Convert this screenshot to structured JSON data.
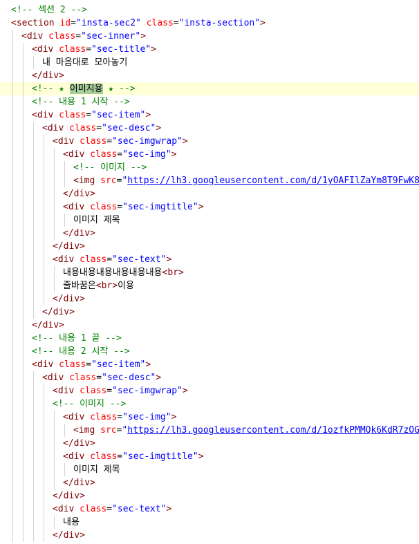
{
  "editor": {
    "language": "html",
    "lines": [
      {
        "indent": 0,
        "tokens": [
          {
            "t": "comment",
            "v": "<!-- 섹션 2 -->"
          }
        ]
      },
      {
        "indent": 0,
        "tokens": [
          {
            "t": "tag",
            "v": "<section"
          },
          {
            "t": "text",
            "v": " "
          },
          {
            "t": "attr",
            "v": "id"
          },
          {
            "t": "text",
            "v": "="
          },
          {
            "t": "value",
            "v": "\"insta-sec2\""
          },
          {
            "t": "text",
            "v": " "
          },
          {
            "t": "attr",
            "v": "class"
          },
          {
            "t": "text",
            "v": "="
          },
          {
            "t": "value",
            "v": "\"insta-section\""
          },
          {
            "t": "tag",
            "v": ">"
          }
        ]
      },
      {
        "indent": 1,
        "tokens": [
          {
            "t": "tag",
            "v": "<div"
          },
          {
            "t": "text",
            "v": " "
          },
          {
            "t": "attr",
            "v": "class"
          },
          {
            "t": "text",
            "v": "="
          },
          {
            "t": "value",
            "v": "\"sec-inner\""
          },
          {
            "t": "tag",
            "v": ">"
          }
        ]
      },
      {
        "indent": 2,
        "tokens": [
          {
            "t": "tag",
            "v": "<div"
          },
          {
            "t": "text",
            "v": " "
          },
          {
            "t": "attr",
            "v": "class"
          },
          {
            "t": "text",
            "v": "="
          },
          {
            "t": "value",
            "v": "\"sec-title\""
          },
          {
            "t": "tag",
            "v": ">"
          }
        ]
      },
      {
        "indent": 3,
        "tokens": [
          {
            "t": "text",
            "v": "내 마음대로 모아놓기"
          }
        ]
      },
      {
        "indent": 2,
        "tokens": [
          {
            "t": "tag",
            "v": "</div>"
          }
        ]
      },
      {
        "indent": 2,
        "highlight": true,
        "tokens": [
          {
            "t": "comment",
            "v": "<!-- ★ "
          },
          {
            "t": "match",
            "v": "이미지용"
          },
          {
            "t": "comment",
            "v": " ★ -->"
          }
        ]
      },
      {
        "indent": 2,
        "tokens": [
          {
            "t": "comment",
            "v": "<!-- 내용 1 시작 -->"
          }
        ]
      },
      {
        "indent": 2,
        "tokens": [
          {
            "t": "tag",
            "v": "<div"
          },
          {
            "t": "text",
            "v": " "
          },
          {
            "t": "attr",
            "v": "class"
          },
          {
            "t": "text",
            "v": "="
          },
          {
            "t": "value",
            "v": "\"sec-item\""
          },
          {
            "t": "tag",
            "v": ">"
          }
        ]
      },
      {
        "indent": 3,
        "tokens": [
          {
            "t": "tag",
            "v": "<div"
          },
          {
            "t": "text",
            "v": " "
          },
          {
            "t": "attr",
            "v": "class"
          },
          {
            "t": "text",
            "v": "="
          },
          {
            "t": "value",
            "v": "\"sec-desc\""
          },
          {
            "t": "tag",
            "v": ">"
          }
        ]
      },
      {
        "indent": 4,
        "tokens": [
          {
            "t": "tag",
            "v": "<div"
          },
          {
            "t": "text",
            "v": " "
          },
          {
            "t": "attr",
            "v": "class"
          },
          {
            "t": "text",
            "v": "="
          },
          {
            "t": "value",
            "v": "\"sec-imgwrap\""
          },
          {
            "t": "tag",
            "v": ">"
          }
        ]
      },
      {
        "indent": 5,
        "tokens": [
          {
            "t": "tag",
            "v": "<div"
          },
          {
            "t": "text",
            "v": " "
          },
          {
            "t": "attr",
            "v": "class"
          },
          {
            "t": "text",
            "v": "="
          },
          {
            "t": "value",
            "v": "\"sec-img\""
          },
          {
            "t": "tag",
            "v": ">"
          }
        ]
      },
      {
        "indent": 6,
        "tokens": [
          {
            "t": "comment",
            "v": "<!-- 이미지 -->"
          }
        ]
      },
      {
        "indent": 6,
        "tokens": [
          {
            "t": "tag",
            "v": "<img"
          },
          {
            "t": "text",
            "v": " "
          },
          {
            "t": "attr",
            "v": "src"
          },
          {
            "t": "text",
            "v": "="
          },
          {
            "t": "value",
            "v": "\""
          },
          {
            "t": "link",
            "v": "https://lh3.googleusercontent.com/d/1yOAFIlZaYm8T9FwK8l"
          }
        ]
      },
      {
        "indent": 5,
        "tokens": [
          {
            "t": "tag",
            "v": "</div>"
          }
        ]
      },
      {
        "indent": 5,
        "tokens": [
          {
            "t": "tag",
            "v": "<div"
          },
          {
            "t": "text",
            "v": " "
          },
          {
            "t": "attr",
            "v": "class"
          },
          {
            "t": "text",
            "v": "="
          },
          {
            "t": "value",
            "v": "\"sec-imgtitle\""
          },
          {
            "t": "tag",
            "v": ">"
          }
        ]
      },
      {
        "indent": 6,
        "tokens": [
          {
            "t": "text",
            "v": "이미지 제목"
          }
        ]
      },
      {
        "indent": 5,
        "tokens": [
          {
            "t": "tag",
            "v": "</div>"
          }
        ]
      },
      {
        "indent": 4,
        "tokens": [
          {
            "t": "tag",
            "v": "</div>"
          }
        ]
      },
      {
        "indent": 4,
        "tokens": [
          {
            "t": "tag",
            "v": "<div"
          },
          {
            "t": "text",
            "v": " "
          },
          {
            "t": "attr",
            "v": "class"
          },
          {
            "t": "text",
            "v": "="
          },
          {
            "t": "value",
            "v": "\"sec-text\""
          },
          {
            "t": "tag",
            "v": ">"
          }
        ]
      },
      {
        "indent": 5,
        "tokens": [
          {
            "t": "text",
            "v": "내용내용내용내용내용내용"
          },
          {
            "t": "tag",
            "v": "<br>"
          }
        ]
      },
      {
        "indent": 5,
        "tokens": [
          {
            "t": "text",
            "v": "줄바꿈은"
          },
          {
            "t": "tag",
            "v": "<br>"
          },
          {
            "t": "text",
            "v": "이용"
          }
        ]
      },
      {
        "indent": 4,
        "tokens": [
          {
            "t": "tag",
            "v": "</div>"
          }
        ]
      },
      {
        "indent": 3,
        "tokens": [
          {
            "t": "tag",
            "v": "</div>"
          }
        ]
      },
      {
        "indent": 2,
        "tokens": [
          {
            "t": "tag",
            "v": "</div>"
          }
        ]
      },
      {
        "indent": 2,
        "tokens": [
          {
            "t": "comment",
            "v": "<!-- 내용 1 끝 -->"
          }
        ]
      },
      {
        "indent": 2,
        "tokens": [
          {
            "t": "comment",
            "v": "<!-- 내용 2 시작 -->"
          }
        ]
      },
      {
        "indent": 2,
        "tokens": [
          {
            "t": "tag",
            "v": "<div"
          },
          {
            "t": "text",
            "v": " "
          },
          {
            "t": "attr",
            "v": "class"
          },
          {
            "t": "text",
            "v": "="
          },
          {
            "t": "value",
            "v": "\"sec-item\""
          },
          {
            "t": "tag",
            "v": ">"
          }
        ]
      },
      {
        "indent": 3,
        "tokens": [
          {
            "t": "tag",
            "v": "<div"
          },
          {
            "t": "text",
            "v": " "
          },
          {
            "t": "attr",
            "v": "class"
          },
          {
            "t": "text",
            "v": "="
          },
          {
            "t": "value",
            "v": "\"sec-desc\""
          },
          {
            "t": "tag",
            "v": ">"
          }
        ]
      },
      {
        "indent": 4,
        "tokens": [
          {
            "t": "tag",
            "v": "<div"
          },
          {
            "t": "text",
            "v": " "
          },
          {
            "t": "attr",
            "v": "class"
          },
          {
            "t": "text",
            "v": "="
          },
          {
            "t": "value",
            "v": "\"sec-imgwrap\""
          },
          {
            "t": "tag",
            "v": ">"
          }
        ]
      },
      {
        "indent": 4,
        "tokens": [
          {
            "t": "comment",
            "v": "<!-- 이미지 -->"
          }
        ]
      },
      {
        "indent": 5,
        "tokens": [
          {
            "t": "tag",
            "v": "<div"
          },
          {
            "t": "text",
            "v": " "
          },
          {
            "t": "attr",
            "v": "class"
          },
          {
            "t": "text",
            "v": "="
          },
          {
            "t": "value",
            "v": "\"sec-img\""
          },
          {
            "t": "tag",
            "v": ">"
          }
        ]
      },
      {
        "indent": 6,
        "tokens": [
          {
            "t": "tag",
            "v": "<img"
          },
          {
            "t": "text",
            "v": " "
          },
          {
            "t": "attr",
            "v": "src"
          },
          {
            "t": "text",
            "v": "="
          },
          {
            "t": "value",
            "v": "\""
          },
          {
            "t": "link",
            "v": "https://lh3.googleusercontent.com/d/1ozfkPMMQk6KdR7zOG_"
          }
        ]
      },
      {
        "indent": 5,
        "tokens": [
          {
            "t": "tag",
            "v": "</div>"
          }
        ]
      },
      {
        "indent": 5,
        "tokens": [
          {
            "t": "tag",
            "v": "<div"
          },
          {
            "t": "text",
            "v": " "
          },
          {
            "t": "attr",
            "v": "class"
          },
          {
            "t": "text",
            "v": "="
          },
          {
            "t": "value",
            "v": "\"sec-imgtitle\""
          },
          {
            "t": "tag",
            "v": ">"
          }
        ]
      },
      {
        "indent": 6,
        "tokens": [
          {
            "t": "text",
            "v": "이미지 제목"
          }
        ]
      },
      {
        "indent": 5,
        "tokens": [
          {
            "t": "tag",
            "v": "</div>"
          }
        ]
      },
      {
        "indent": 4,
        "tokens": [
          {
            "t": "tag",
            "v": "</div>"
          }
        ]
      },
      {
        "indent": 4,
        "tokens": [
          {
            "t": "tag",
            "v": "<div"
          },
          {
            "t": "text",
            "v": " "
          },
          {
            "t": "attr",
            "v": "class"
          },
          {
            "t": "text",
            "v": "="
          },
          {
            "t": "value",
            "v": "\"sec-text\""
          },
          {
            "t": "tag",
            "v": ">"
          }
        ]
      },
      {
        "indent": 5,
        "tokens": [
          {
            "t": "text",
            "v": "내용"
          }
        ]
      },
      {
        "indent": 4,
        "tokens": [
          {
            "t": "tag",
            "v": "</div>"
          }
        ]
      }
    ]
  }
}
